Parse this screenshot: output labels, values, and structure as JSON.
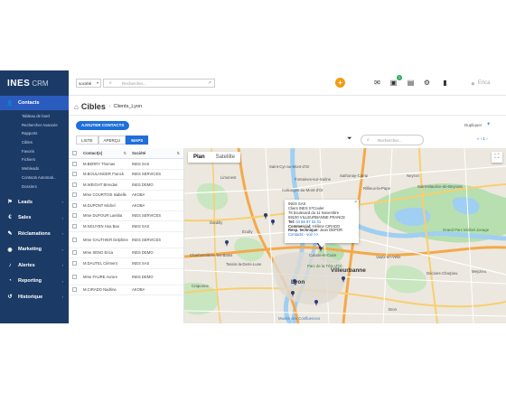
{
  "header": {
    "logo_main": "INES",
    "logo_sub": "CRM",
    "company_select": "société",
    "search_placeholder": "Rechercher...",
    "user_name": "Erica"
  },
  "sidebar": {
    "sections": [
      {
        "label": "Contacts",
        "icon": "user-icon",
        "active": true
      },
      {
        "label": "Leads",
        "icon": "leads-icon"
      },
      {
        "label": "Sales",
        "icon": "sales-icon"
      },
      {
        "label": "Réclamations",
        "icon": "complaint-icon"
      },
      {
        "label": "Marketing",
        "icon": "marketing-icon"
      },
      {
        "label": "Alertes",
        "icon": "bell-icon"
      },
      {
        "label": "Reporting",
        "icon": "reporting-icon"
      },
      {
        "label": "Historique",
        "icon": "history-icon"
      }
    ],
    "contacts_items": [
      "Tableau de bord",
      "Rechercher Avancée",
      "Rapports",
      "Cibles",
      "Favoris",
      "Fichiers",
      "Webleads",
      "Contacts Automati...",
      "Dossiers"
    ]
  },
  "main": {
    "title": "Cibles",
    "subtitle": "Clients_Lyon",
    "add_button": "AJOUTER CONTACTS",
    "duplicate_label": "Dupliquer",
    "tabs": [
      "LISTE",
      "APERÇU",
      "MAPS"
    ],
    "active_tab": "MAPS",
    "search_placeholder": "Rechercher...",
    "pager": "« ‹ 1 ›",
    "table": {
      "headers": [
        "Contact(s)",
        "Société"
      ],
      "rows": [
        [
          "M.BERRY Thomas",
          "INES SAS"
        ],
        [
          "M.BOULANGER Franck",
          "INES SERVICES"
        ],
        [
          "M.WEIGHT Brendan",
          "INES DEMO"
        ],
        [
          "Mme COURTOIS Isabelle",
          "AKOBA"
        ],
        [
          "M.DUPONT Michel",
          "AKOBA"
        ],
        [
          "Mme DUFOUR Laetitia",
          "INES SERVICES"
        ],
        [
          "M.NGUYEN Hoa Bao",
          "INES SAS"
        ],
        [
          "Mme GAUTHIER Delphine",
          "INES SERVICES"
        ],
        [
          "Mme SENG Erica",
          "INES DEMO"
        ],
        [
          "M.DAUTEL Clément",
          "INES SAS"
        ],
        [
          "Mme FAURE Aurore",
          "INES DEMO"
        ],
        [
          "M.CIRADO Nadrine",
          "AKOBA"
        ]
      ]
    }
  },
  "map": {
    "tabs": [
      "Plan",
      "Satellite"
    ],
    "active_tab": "Plan",
    "labels": {
      "lyon": "Lyon",
      "villeurbanne": "Villeurbanne",
      "vaulx": "Vaulx-en-Velin",
      "caluire": "Caluire-et-Cuire",
      "rillieux": "Rillieux-la-Pape",
      "sathonay": "Sathonay-Camp",
      "dardilly": "Dardilly",
      "ecully": "Écully",
      "tassin": "Tassin-la-Demi-Lune",
      "bron": "Bron",
      "meyzieu": "Meyzieu",
      "decines": "Décines-Charpieu",
      "grandparc": "Grand Parc Miribel Jonage",
      "teteor": "Parc de la Tête d'Or",
      "confluences": "Musée des Confluences",
      "neyron": "Neyron",
      "beynost": "Saint-Maurice-de-Beynost",
      "fontaines": "Fontaines-sur-Saône",
      "collonges": "Collonges-au-Mont-d'Or",
      "limonest": "Limonest",
      "charbonnieres": "Charbonnières-les-Bains",
      "craponne": "Craponne",
      "cyr": "Saint-Cyr-au-Mont-d'Or"
    },
    "info": {
      "company": "INES SAS",
      "type": "Client INES S*Couler",
      "address": "76 boulevard du 11 Novembre",
      "city": "69100 VILLEURBANNE FRANCE",
      "tel_label": "Tel:",
      "tel": "04 66 97 02 01",
      "commercial_label": "Commercial:",
      "commercial": "Hélène CIRADO",
      "resp_label": "Resp. technique:",
      "resp": "Jean DEPOR",
      "link": "Contacts - voir >>"
    },
    "pins": 9,
    "colors": {
      "park": "#b7dfb0",
      "water": "#9fcff2",
      "road": "#f7cf6f",
      "highway": "#f4a94a",
      "land": "#ece8df"
    }
  },
  "colors": {
    "sidebar_bg": "#1c3a66",
    "accent": "#1e6fd9",
    "orange": "#f39c12",
    "green_badge": "#27ae60"
  }
}
